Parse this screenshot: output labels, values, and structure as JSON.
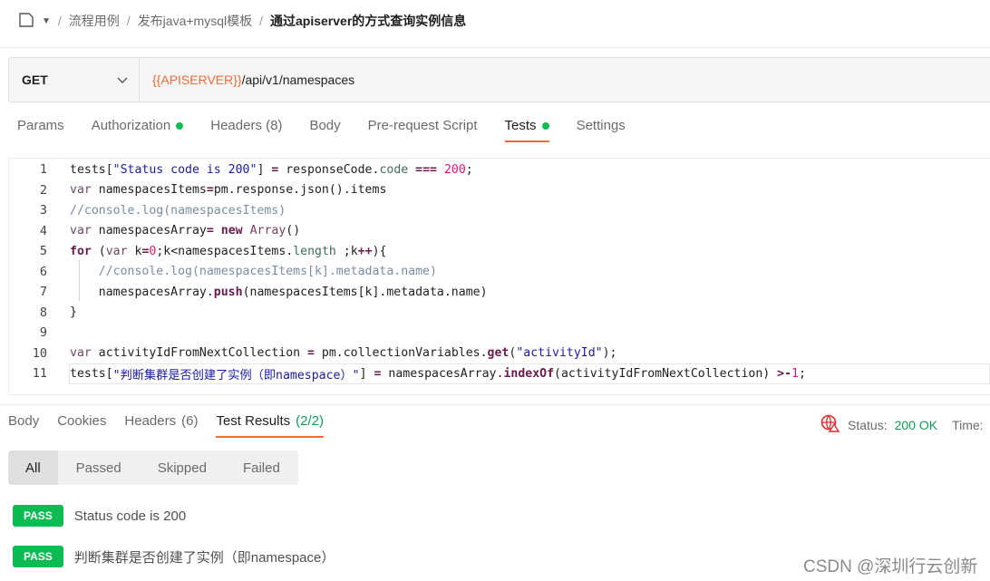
{
  "breadcrumb": {
    "icon": "collection-icon",
    "items": [
      "流程用例",
      "发布java+mysql模板"
    ],
    "current": "通过apiserver的方式查询实例信息"
  },
  "request": {
    "method": "GET",
    "url_var": "{{APISERVER}}",
    "url_path": "/api/v1/namespaces"
  },
  "tabs": [
    {
      "label": "Params"
    },
    {
      "label": "Authorization",
      "dot": true
    },
    {
      "label": "Headers (8)"
    },
    {
      "label": "Body"
    },
    {
      "label": "Pre-request Script"
    },
    {
      "label": "Tests",
      "dot": true,
      "active": true
    },
    {
      "label": "Settings"
    }
  ],
  "code": [
    [
      [
        "id",
        "tests["
      ],
      [
        "str",
        "\"Status code is 200\""
      ],
      [
        "id",
        "] "
      ],
      [
        "kw",
        "="
      ],
      [
        "id",
        " responseCode."
      ],
      [
        "prop",
        "code"
      ],
      [
        "id",
        " "
      ],
      [
        "kw",
        "==="
      ],
      [
        "id",
        " "
      ],
      [
        "num",
        "200"
      ],
      [
        "id",
        ";"
      ]
    ],
    [
      [
        "var",
        "var"
      ],
      [
        "id",
        " namespacesItems"
      ],
      [
        "kw",
        "="
      ],
      [
        "id",
        "pm.response.json().items"
      ]
    ],
    [
      [
        "com",
        "//console.log(namespacesItems)"
      ]
    ],
    [
      [
        "var",
        "var"
      ],
      [
        "id",
        " namespacesArray"
      ],
      [
        "kw",
        "="
      ],
      [
        "id",
        " "
      ],
      [
        "kw",
        "new"
      ],
      [
        "id",
        " "
      ],
      [
        "cls",
        "Array"
      ],
      [
        "id",
        "()"
      ]
    ],
    [
      [
        "kw",
        "for"
      ],
      [
        "id",
        " ("
      ],
      [
        "var",
        "var"
      ],
      [
        "id",
        " k"
      ],
      [
        "kw",
        "="
      ],
      [
        "num",
        "0"
      ],
      [
        "id",
        ";k<namespacesItems."
      ],
      [
        "prop",
        "length"
      ],
      [
        "id",
        " ;k"
      ],
      [
        "kw",
        "++"
      ],
      [
        "id",
        "){"
      ]
    ],
    [
      [
        "id",
        "    "
      ],
      [
        "com",
        "//console.log(namespacesItems[k].metadata.name)"
      ]
    ],
    [
      [
        "id",
        "    namespacesArray."
      ],
      [
        "kw",
        "push"
      ],
      [
        "id",
        "(namespacesItems[k].metadata.name)"
      ]
    ],
    [
      [
        "id",
        "}"
      ]
    ],
    [],
    [
      [
        "var",
        "var"
      ],
      [
        "id",
        " activityIdFromNextCollection "
      ],
      [
        "kw",
        "="
      ],
      [
        "id",
        " pm.collectionVariables."
      ],
      [
        "kw",
        "get"
      ],
      [
        "id",
        "("
      ],
      [
        "str",
        "\"activityId\""
      ],
      [
        "id",
        ");"
      ]
    ],
    [
      [
        "id",
        "tests["
      ],
      [
        "str",
        "\"判断集群是否创建了实例（即namespace）\""
      ],
      [
        "id",
        "] "
      ],
      [
        "kw",
        "="
      ],
      [
        "id",
        " namespacesArray."
      ],
      [
        "kw",
        "indexOf"
      ],
      [
        "id",
        "(activityIdFromNextCollection) "
      ],
      [
        "kw",
        ">-"
      ],
      [
        "num",
        "1"
      ],
      [
        "id",
        ";"
      ]
    ]
  ],
  "response_tabs": [
    {
      "label": "Body"
    },
    {
      "label": "Cookies"
    },
    {
      "label": "Headers",
      "count": "(6)"
    },
    {
      "label": "Test Results",
      "count": "(2/2)",
      "active": true
    }
  ],
  "status": {
    "icon": "network-globe-warning-icon",
    "label": "Status:",
    "value": "200 OK",
    "time_label": "Time:"
  },
  "filters": [
    "All",
    "Passed",
    "Skipped",
    "Failed"
  ],
  "results": [
    {
      "badge": "PASS",
      "name": "Status code is 200"
    },
    {
      "badge": "PASS",
      "name": "判断集群是否创建了实例（即namespace）"
    }
  ],
  "watermark": "CSDN @深圳行云创新",
  "colors": {
    "accent": "#f26b3a",
    "pass": "#0cbb52",
    "ok": "#0f9d58"
  }
}
